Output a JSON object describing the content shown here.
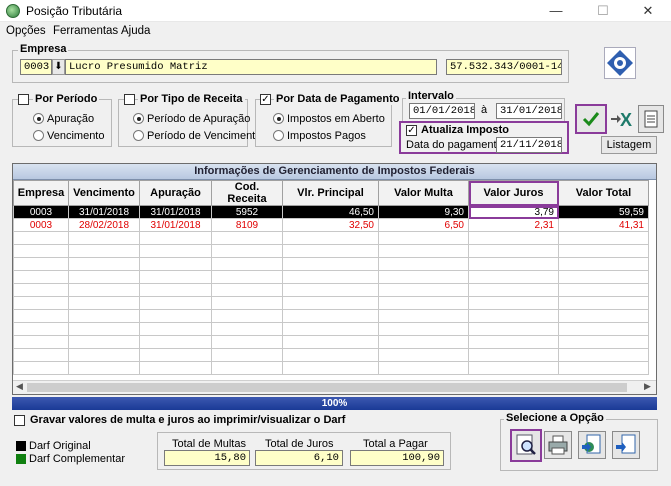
{
  "window": {
    "title": "Posição Tributária",
    "minimize": "—",
    "maximize": "☐",
    "close": "✕"
  },
  "menu": [
    "Opções",
    "Ferramentas",
    "Ajuda"
  ],
  "empresa": {
    "label": "Empresa",
    "code": "0003",
    "name": "Lucro Presumido Matriz",
    "cnpj": "57.532.343/0001-14"
  },
  "filters": {
    "periodo": {
      "label": "Por Período",
      "checked": false,
      "options": [
        "Apuração",
        "Vencimento"
      ],
      "selected": "Apuração"
    },
    "tipo": {
      "label": "Por Tipo de Receita",
      "checked": false,
      "options": [
        "Período de Apuração",
        "Período de Vencimento"
      ],
      "selected": "Período de Apuração"
    },
    "data_pagamento": {
      "label": "Por Data de Pagamento",
      "checked": true,
      "options": [
        "Impostos em Aberto",
        "Impostos Pagos"
      ],
      "selected": "Impostos em Aberto"
    }
  },
  "intervalo": {
    "label": "Intervalo",
    "from": "01/01/2018",
    "sep": "à",
    "to": "31/01/2018"
  },
  "atualiza": {
    "label": "Atualiza Imposto",
    "checked": true,
    "date_label": "Data do pagamento:",
    "date": "21/11/2018"
  },
  "buttons": {
    "listagem": "Listagem"
  },
  "grid": {
    "title": "Informações de Gerenciamento de Impostos Federais",
    "columns": [
      "Empresa",
      "Vencimento",
      "Apuração",
      "Cod. Receita",
      "Vlr. Principal",
      "Valor Multa",
      "Valor Juros",
      "Valor Total"
    ],
    "rows": [
      [
        "0003",
        "31/01/2018",
        "31/01/2018",
        "5952",
        "46,50",
        "9,30",
        "3,79",
        "59,59"
      ],
      [
        "0003",
        "28/02/2018",
        "31/01/2018",
        "8109",
        "32,50",
        "6,50",
        "2,31",
        "41,31"
      ]
    ],
    "progress": "100%"
  },
  "gravar": {
    "label": "Gravar valores de multa e juros ao imprimir/visualizar o Darf",
    "checked": false
  },
  "legend": [
    {
      "label": "Darf Original",
      "color": "#000000"
    },
    {
      "label": "Darf Complementar",
      "color": "#108010"
    }
  ],
  "totals": {
    "multas_label": "Total de Multas",
    "multas": "15,80",
    "juros_label": "Total de Juros",
    "juros": "6,10",
    "pagar_label": "Total a Pagar",
    "pagar": "100,90"
  },
  "opcao": {
    "label": "Selecione a Opção"
  }
}
